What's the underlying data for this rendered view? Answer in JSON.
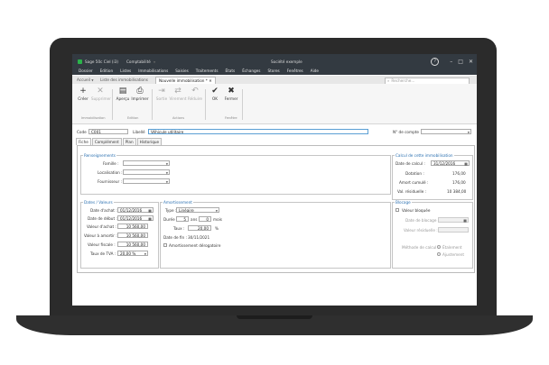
{
  "app": {
    "name": "Sage 50c Ciel (i3)",
    "module": "Comptabilité",
    "company": "Société exemple"
  },
  "menu": [
    "Dossier",
    "Edition",
    "Listes",
    "Immobilisations",
    "Saisies",
    "Traitements",
    "États",
    "Échanges",
    "Stores",
    "Fenêtres",
    "Aide"
  ],
  "tabs": {
    "home": "Accueil",
    "list": "Liste des immobilisations",
    "current": "Nouvelle immobilisation *"
  },
  "search": {
    "placeholder": "Recherche..."
  },
  "ribbon": {
    "creer": "Créer",
    "supprimer": "Supprimer",
    "apercu": "Aperçu",
    "imprimer": "Imprimer",
    "sortie": "Sortie",
    "virement": "Virement",
    "reduire": "Réduire",
    "ok": "OK",
    "fermer": "Fermer",
    "groups": {
      "immobilisation": "Immobilisation",
      "edition": "Edition",
      "actions": "Actions",
      "fenetre": "Fenêtre"
    }
  },
  "form": {
    "code_label": "Code",
    "code_value": "C001",
    "libelle_label": "Libellé",
    "libelle_value": "Véhicule utilitaire",
    "compte_label": "N° de compte"
  },
  "inner_tabs": [
    "Fiche",
    "Complément",
    "Plan",
    "Historique"
  ],
  "renseignements": {
    "title": "Renseignements",
    "famille": "Famille :",
    "localisation": "Localisation :",
    "fournisseur": "Fournisseur :"
  },
  "calcul": {
    "title": "Calcul de cette immobilisation",
    "date_calcul_label": "Date de calcul :",
    "date_calcul": "31/12/2016",
    "dotation_label": "Dotation :",
    "dotation": "176,00",
    "amort_cumule_label": "Amort cumulé :",
    "amort_cumule": "176,00",
    "val_residuelle_label": "Val. résiduelle :",
    "val_residuelle": "10 384,00"
  },
  "dates": {
    "title": "Dates / Valeurs",
    "date_achat_label": "Date d'achat :",
    "date_achat": "01/12/2016",
    "date_debut_label": "Date de début :",
    "date_debut": "01/12/2016",
    "valeur_achat_label": "Valeur d'achat :",
    "valeur_achat": "10 560,00",
    "valeur_amortir_label": "Valeur à amortir :",
    "valeur_amortir": "10 560,00",
    "valeur_fiscale_label": "Valeur fiscale :",
    "valeur_fiscale": "10 560,00",
    "taux_tva_label": "Taux de TVA :",
    "taux_tva": "20,00 %"
  },
  "amortissement": {
    "title": "Amortissement",
    "type_label": "Type :",
    "type": "Linéaire",
    "duree_label": "Durée :",
    "duree_ans": "5",
    "ans": "ans",
    "duree_mois": "0",
    "mois": "mois",
    "taux_label": "Taux :",
    "taux": "20,00",
    "pct": "%",
    "date_fin_label": "Date de fin :",
    "date_fin": "30/11/2021",
    "derogatoire": "Amortissement dérogatoire"
  },
  "blocage": {
    "title": "Blocage",
    "valeur_bloquee": "Valeur bloquée",
    "date_blocage_label": "Date de blocage :",
    "valeur_residuelle_label": "Valeur résiduelle :",
    "methode_label": "Méthode de calcul :",
    "etalement": "Étalement",
    "ajustement": "Ajustement"
  },
  "colors": {
    "titlebar": "#333a41",
    "accent": "#2a6fb0",
    "bezel": "#2b2b2b"
  }
}
